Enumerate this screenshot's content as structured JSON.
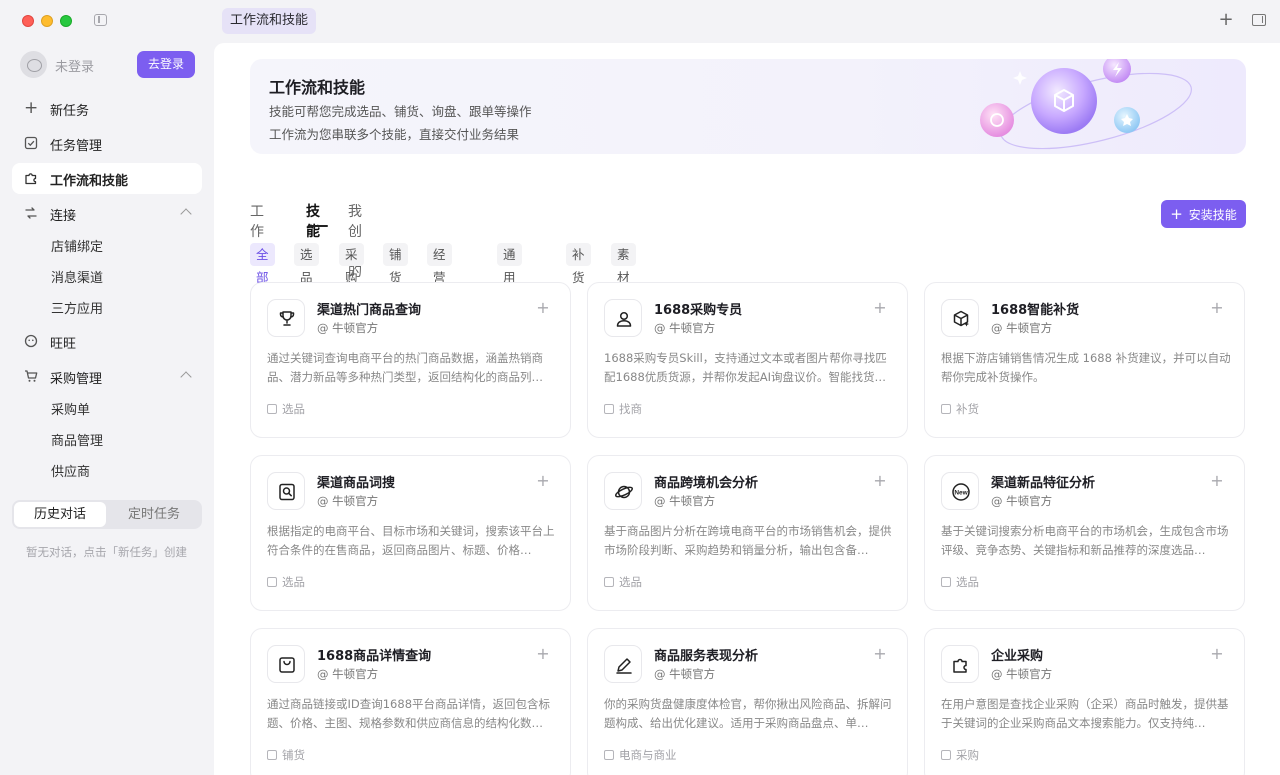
{
  "window": {
    "tab_title": "工作流和技能"
  },
  "user": {
    "name": "未登录",
    "login_label": "去登录"
  },
  "sidebar": {
    "items": [
      {
        "label": "新任务",
        "icon": "plus-icon"
      },
      {
        "label": "任务管理",
        "icon": "checklist-icon"
      },
      {
        "label": "工作流和技能",
        "icon": "puzzle-icon"
      },
      {
        "label": "连接",
        "icon": "link-icon"
      },
      {
        "label": "旺旺",
        "icon": "chat-face-icon"
      },
      {
        "label": "采购管理",
        "icon": "cart-icon"
      }
    ],
    "connect_sub": [
      "店铺绑定",
      "消息渠道",
      "三方应用"
    ],
    "purchase_sub": [
      "采购单",
      "商品管理",
      "供应商"
    ],
    "segment": {
      "left": "历史对话",
      "right": "定时任务"
    },
    "empty_hint": "暂无对话，点击「新任务」创建"
  },
  "banner": {
    "title": "工作流和技能",
    "line1": "技能可帮您完成选品、铺货、询盘、跟单等操作",
    "line2": "工作流为您串联多个技能，直接交付业务结果"
  },
  "tabs": [
    "工作流",
    "技能",
    "我创建的"
  ],
  "install_label": "安装技能",
  "filters": [
    "全部",
    "选品",
    "采购",
    "铺货",
    "经营分析",
    "通用工具",
    "补货",
    "素材"
  ],
  "cards": [
    {
      "name": "渠道热门商品查询",
      "author": "@ 牛顿官方",
      "desc": "通过关键词查询电商平台的热门商品数据，涵盖热销商品、潜力新品等多种热门类型，返回结构化的商品列…",
      "tag": "选品",
      "icon": "trophy-icon"
    },
    {
      "name": "1688采购专员",
      "author": "@ 牛顿官方",
      "desc": "1688采购专员Skill，支持通过文本或者图片帮你寻找匹配1688优质货源，并帮你发起AI询盘议价。智能找货…",
      "tag": "找商",
      "icon": "person-icon"
    },
    {
      "name": "1688智能补货",
      "author": "@ 牛顿官方",
      "desc": "根据下游店铺销售情况生成 1688 补货建议，并可以自动帮你完成补货操作。",
      "tag": "补货",
      "icon": "box-sparkle-icon"
    },
    {
      "name": "渠道商品词搜",
      "author": "@ 牛顿官方",
      "desc": "根据指定的电商平台、目标市场和关键词，搜索该平台上符合条件的在售商品，返回商品图片、标题、价格…",
      "tag": "选品",
      "icon": "search-doc-icon"
    },
    {
      "name": "商品跨境机会分析",
      "author": "@ 牛顿官方",
      "desc": "基于商品图片分析在跨境电商平台的市场销售机会，提供市场阶段判断、采购趋势和销量分析，输出包含备…",
      "tag": "选品",
      "icon": "planet-icon"
    },
    {
      "name": "渠道新品特征分析",
      "author": "@ 牛顿官方",
      "desc": "基于关键词搜索分析电商平台的市场机会，生成包含市场评级、竞争态势、关键指标和新品推荐的深度选品…",
      "tag": "选品",
      "icon": "new-badge-icon"
    },
    {
      "name": "1688商品详情查询",
      "author": "@ 牛顿官方",
      "desc": "通过商品链接或ID查询1688平台商品详情，返回包含标题、价格、主图、规格参数和供应商信息的结构化数…",
      "tag": "铺货",
      "icon": "bag-icon"
    },
    {
      "name": "商品服务表现分析",
      "author": "@ 牛顿官方",
      "desc": "你的采购货盘健康度体检官，帮你揪出风险商品、拆解问题构成、给出优化建议。适用于采购商品盘点、单…",
      "tag": "电商与商业",
      "icon": "pen-icon"
    },
    {
      "name": "企业采购",
      "author": "@ 牛顿官方",
      "desc": "在用户意图是查找企业采购（企采）商品时触发，提供基于关键词的企业采购商品文本搜索能力。仅支持纯…",
      "tag": "采购",
      "icon": "puzzle-icon"
    }
  ],
  "colors": {
    "accent": "#7c5ef0",
    "active_chip_bg": "#ece8fd"
  }
}
